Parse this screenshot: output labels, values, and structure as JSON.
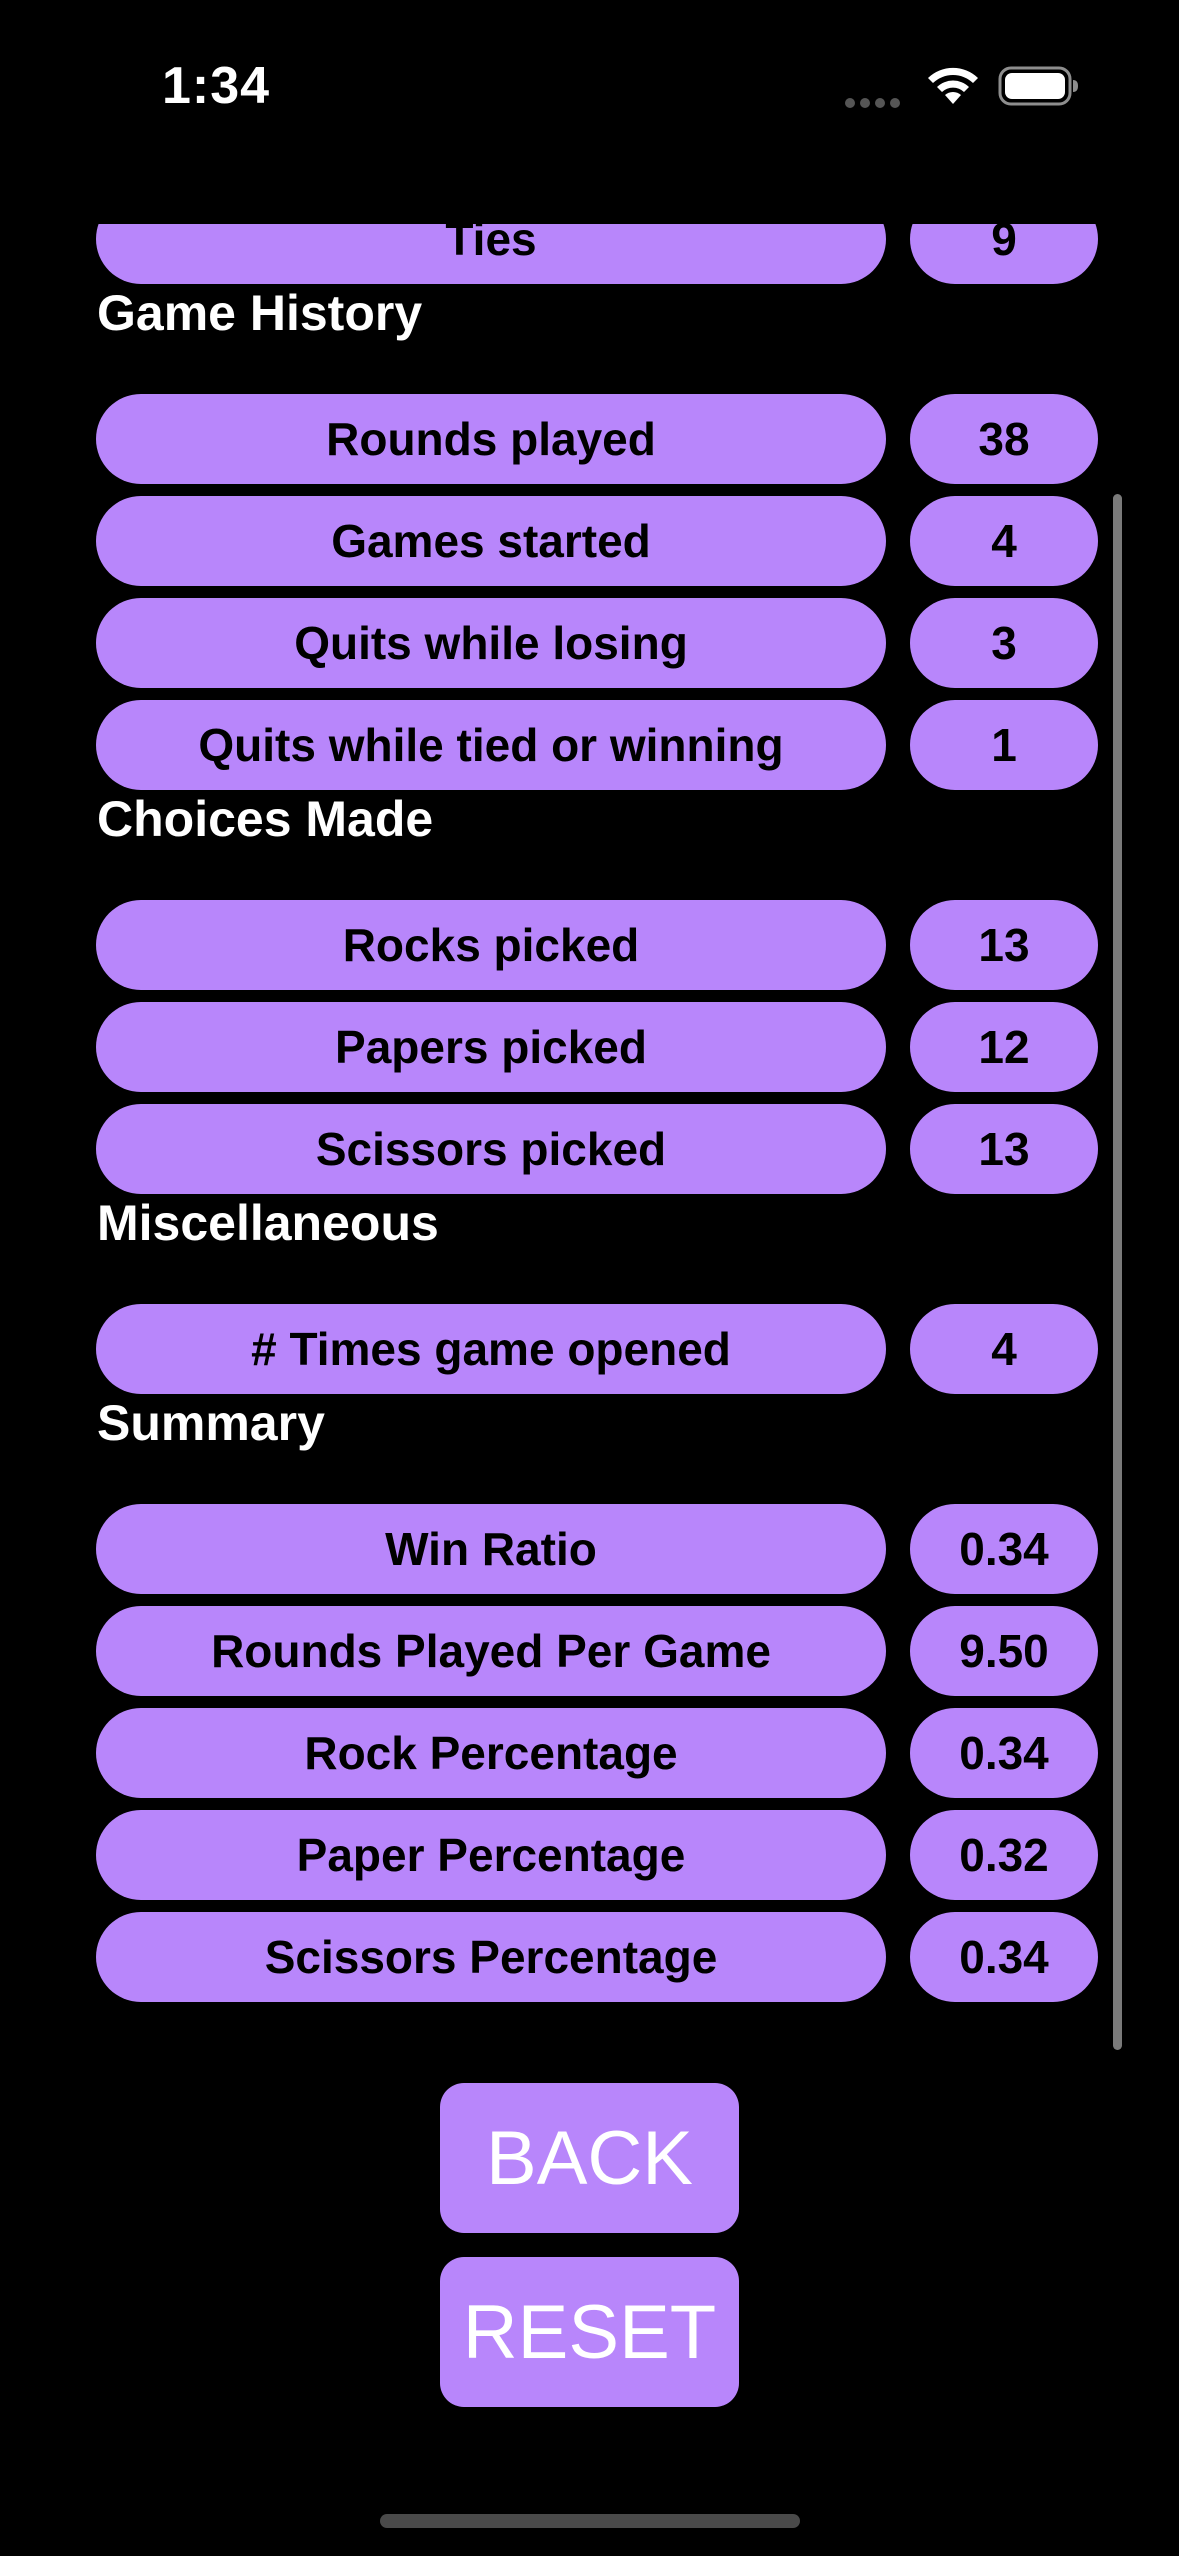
{
  "status_bar": {
    "time": "1:34",
    "icons": [
      "signal-dots-icon",
      "wifi-icon",
      "battery-icon"
    ]
  },
  "stats": {
    "top_partial": [
      {
        "label": "Ties",
        "value": "9"
      }
    ],
    "sections": [
      {
        "heading": "Game History",
        "rows": [
          {
            "label": "Rounds played",
            "value": "38"
          },
          {
            "label": "Games started",
            "value": "4"
          },
          {
            "label": "Quits while losing",
            "value": "3"
          },
          {
            "label": "Quits while tied or winning",
            "value": "1"
          }
        ]
      },
      {
        "heading": "Choices Made",
        "rows": [
          {
            "label": "Rocks picked",
            "value": "13"
          },
          {
            "label": "Papers picked",
            "value": "12"
          },
          {
            "label": "Scissors picked",
            "value": "13"
          }
        ]
      },
      {
        "heading": "Miscellaneous",
        "rows": [
          {
            "label": "# Times game opened",
            "value": "4"
          }
        ]
      },
      {
        "heading": "Summary",
        "rows": [
          {
            "label": "Win Ratio",
            "value": "0.34"
          },
          {
            "label": "Rounds Played Per Game",
            "value": "9.50"
          },
          {
            "label": "Rock Percentage",
            "value": "0.34"
          },
          {
            "label": "Paper Percentage",
            "value": "0.32"
          },
          {
            "label": "Scissors Percentage",
            "value": "0.34"
          }
        ]
      }
    ]
  },
  "buttons": {
    "back_label": "BACK",
    "reset_label": "RESET"
  },
  "colors": {
    "background": "#000000",
    "pill": "#b886fb",
    "pill_text": "#000000",
    "heading_text": "#ffffff"
  }
}
